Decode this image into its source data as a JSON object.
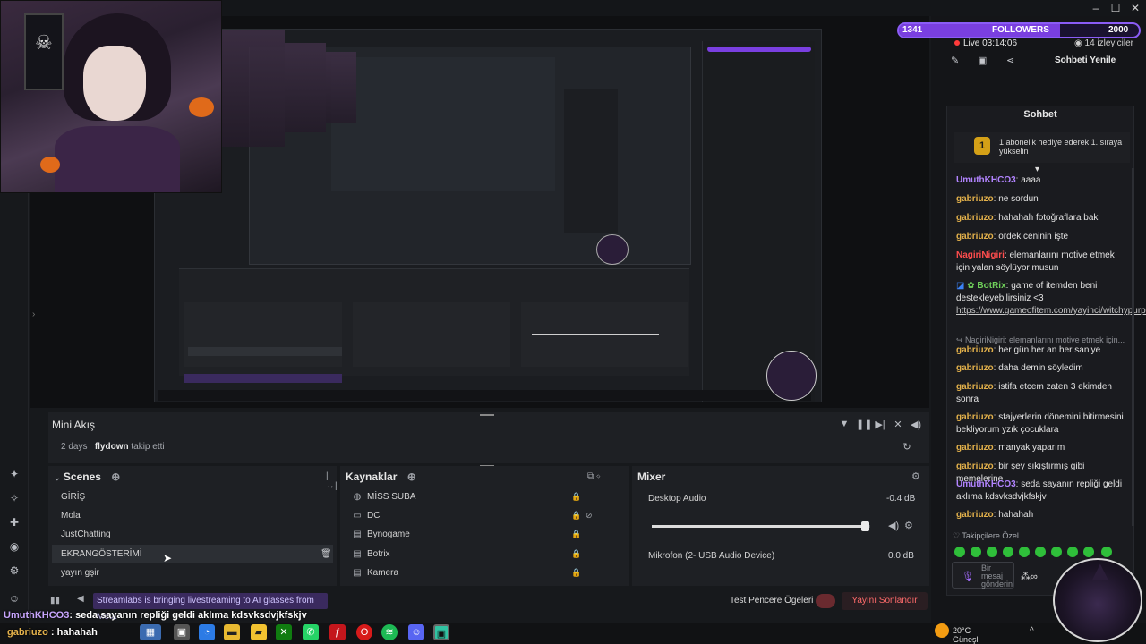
{
  "followers": {
    "current": "1341",
    "label": "FOLLOWERS",
    "goal": "2000",
    "progress": 0.67
  },
  "live": {
    "time": "Live 03:14:06",
    "viewers": "14 izleyiciler",
    "refresh": "Sohbeti Yenile"
  },
  "chat": {
    "title": "Sohbet",
    "hype_badge": "1",
    "hype_text": "1 abonelik hediye ederek 1. sıraya yükselin",
    "messages": [
      {
        "user": "UmuthKHCO3",
        "sep": ": ",
        "text": "aaaa",
        "color": "p"
      },
      {
        "user": "gabriuzo",
        "sep": ": ",
        "text": "ne sordun",
        "color": "g"
      },
      {
        "user": "gabriuzo",
        "sep": ": ",
        "text": "hahahah fotoğraflara bak",
        "color": "g"
      },
      {
        "user": "gabriuzo",
        "sep": ": ",
        "text": "ördek ceninin işte",
        "color": "g"
      },
      {
        "user": "NagiriNigiri",
        "sep": ": ",
        "text": "elemanlarını motive etmek için yalan söylüyor musun",
        "color": "r"
      },
      {
        "user": "BotRix",
        "sep": ": ",
        "text": "game of itemden beni destekleyebilirsiniz <3",
        "link": "https://www.gameofitem.com/yayinci/witchypurple",
        "color": "b"
      },
      {
        "user": "",
        "sep": "",
        "text": "↪ NagiriNigiri: elemanlarını motive etmek için...",
        "color": "reply"
      },
      {
        "user": "gabriuzo",
        "sep": ": ",
        "text": "her gün her an her saniye",
        "color": "g"
      },
      {
        "user": "gabriuzo",
        "sep": ": ",
        "text": "daha demin söyledim",
        "color": "g"
      },
      {
        "user": "gabriuzo",
        "sep": ": ",
        "text": "istifa etcem zaten 3 ekimden sonra",
        "color": "g"
      },
      {
        "user": "gabriuzo",
        "sep": ": ",
        "text": "stajyerlerin dönemini bitirmesini bekliyorum yzık çocuklara",
        "color": "g"
      },
      {
        "user": "gabriuzo",
        "sep": ": ",
        "text": "manyak yaparım",
        "color": "g"
      },
      {
        "user": "gabriuzo",
        "sep": ": ",
        "text": "bir şey sıkıştırmış gibi memelerine",
        "color": "g"
      },
      {
        "user": "UmuthKHCO3",
        "sep": ": ",
        "text": "seda sayanın repliği geldi aklıma kdsvksdvjkfskjv",
        "color": "p"
      },
      {
        "user": "gabriuzo",
        "sep": ": ",
        "text": "hahahah",
        "color": "g"
      }
    ],
    "emote_label": "Takipçilere Özel",
    "input_placeholder": "Bir mesaj gönderin"
  },
  "mini_akis": {
    "title": "Mini Akış",
    "age": "2 days",
    "user": "flydown",
    "action": "takip etti"
  },
  "scenes": {
    "title": "Scenes",
    "items": [
      "GİRİŞ",
      "Mola",
      "JustChatting",
      "EKRANGÖSTERİMİ",
      "yayın gşir"
    ],
    "selected": 3
  },
  "sources": {
    "title": "Kaynaklar",
    "items": [
      "MİSS SUBA",
      "DC",
      "Bynogame",
      "Botrix",
      "Kamera"
    ]
  },
  "mixer": {
    "title": "Mixer",
    "channels": [
      {
        "name": "Desktop Audio",
        "db": "-0.4 dB",
        "level": 0.98
      },
      {
        "name": "Mikrofon (2- USB Audio Device)",
        "db": "0.0 dB",
        "level": 0
      }
    ]
  },
  "status": {
    "news": "Streamlabs is bringing livestreaming to AI glasses from Meta",
    "test": "Test Pencere Ögeleri",
    "end": "Yayını Sonlandır"
  },
  "overlay_chat": [
    {
      "user": "UmuthKHCO3",
      "text": ": seda sayanın repliği geldi aklıma kdsvksdvjkfskjv"
    },
    {
      "user": "gabriuzo",
      "text": " : hahahah"
    }
  ],
  "weather": {
    "temp": "20°C",
    "desc": "Güneşli"
  },
  "colors": {
    "accent": "#8b5cf6",
    "end_button": "#ff6b6b",
    "gold": "#e3b14b",
    "purple_user": "#b284ff"
  }
}
